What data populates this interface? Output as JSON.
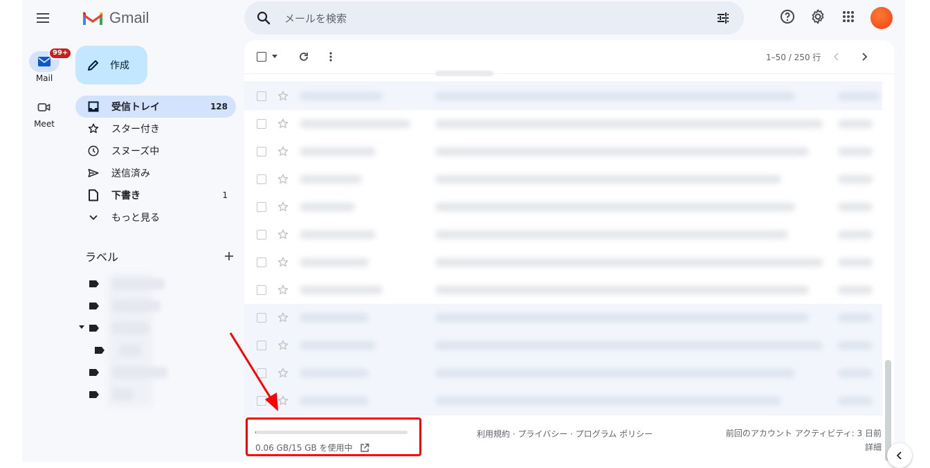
{
  "app": {
    "name": "Gmail"
  },
  "search": {
    "placeholder": "メールを検索"
  },
  "rail": {
    "mail": {
      "label": "Mail",
      "badge": "99+"
    },
    "meet": {
      "label": "Meet"
    }
  },
  "compose": {
    "label": "作成"
  },
  "nav": [
    {
      "label": "受信トレイ",
      "count": "128",
      "icon": "inbox-icon",
      "active": true
    },
    {
      "label": "スター付き",
      "count": "",
      "icon": "star-icon"
    },
    {
      "label": "スヌーズ中",
      "count": "",
      "icon": "clock-icon"
    },
    {
      "label": "送信済み",
      "count": "",
      "icon": "send-icon"
    },
    {
      "label": "下書き",
      "count": "1",
      "icon": "draft-icon"
    },
    {
      "label": "もっと見る",
      "count": "",
      "icon": "chevron-down-icon"
    }
  ],
  "labels": {
    "heading": "ラベル"
  },
  "toolbar": {
    "pager": "1–50 / 250 行"
  },
  "footer": {
    "storage": "0.06 GB/15 GB を使用中",
    "storage_fraction": 0.004,
    "links": "利用規約 · プライバシー · プログラム ポリシー",
    "activity": "前回のアカウント アクティビティ: 3 日前",
    "details": "詳細"
  },
  "colors": {
    "accent": "#1a73e8",
    "highlight": "#ff0000",
    "compose": "#c2e7ff",
    "active_nav": "#d3e3fd",
    "badge": "#c5221f"
  }
}
